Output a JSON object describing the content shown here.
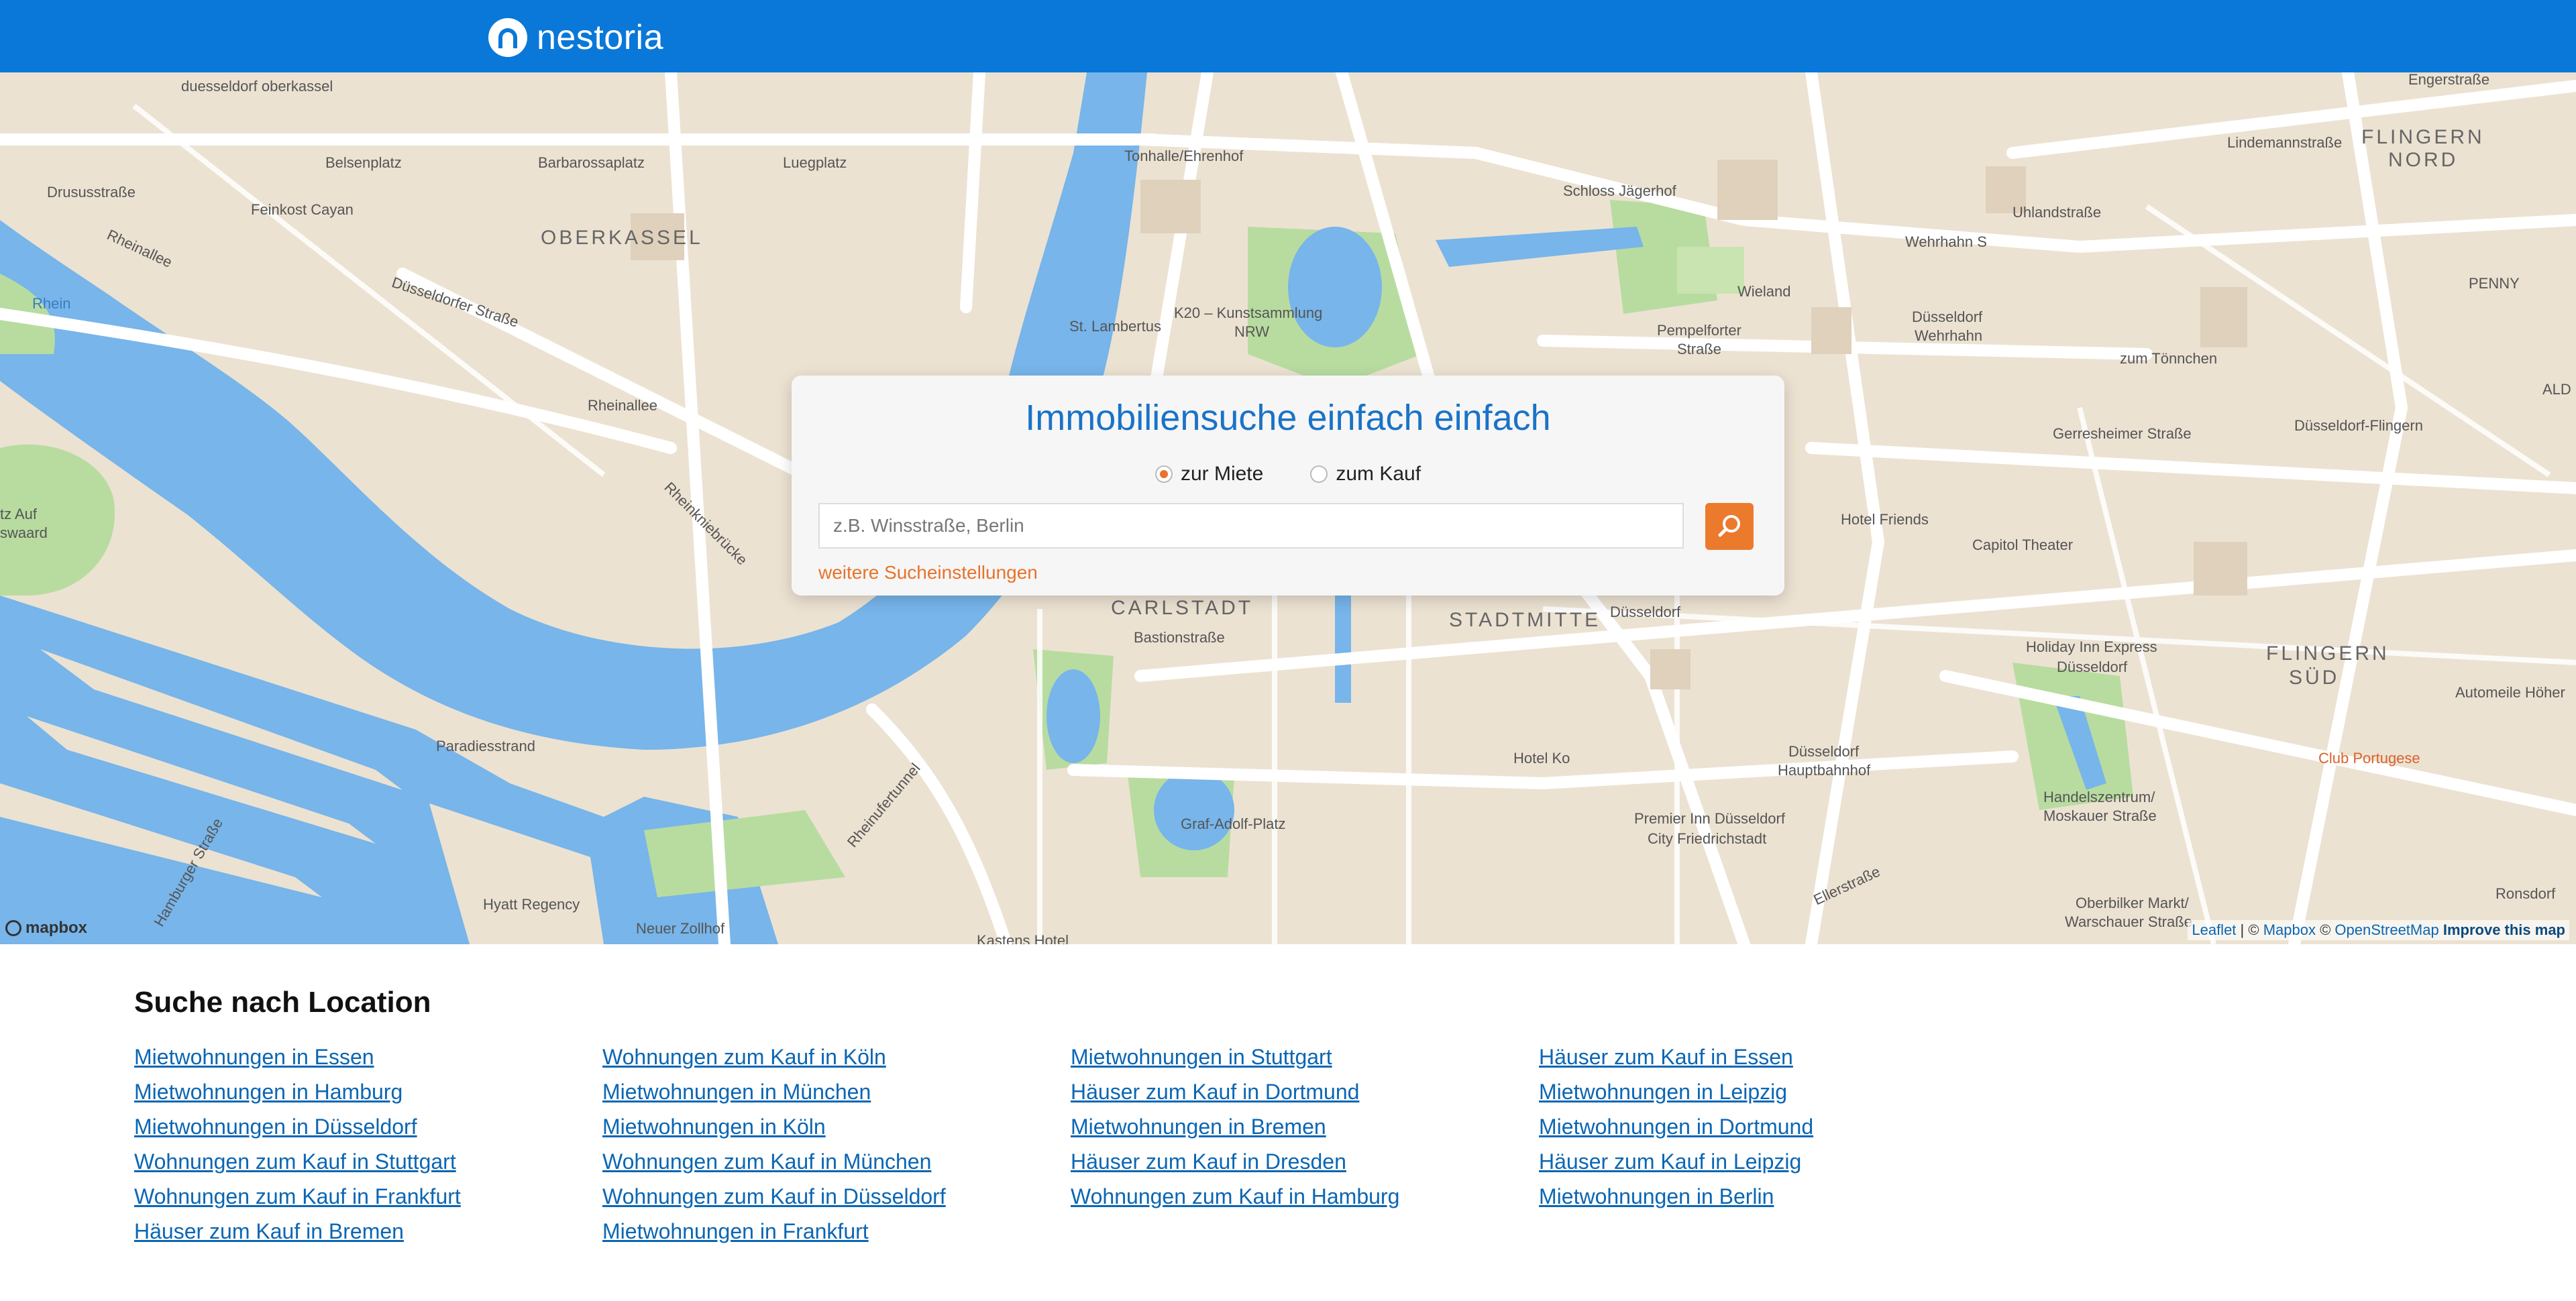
{
  "header": {
    "logo_text": "nestoria"
  },
  "search": {
    "title": "Immobiliensuche einfach einfach",
    "radio_rent": "zur Miete",
    "radio_buy": "zum Kauf",
    "selected": "zur Miete",
    "placeholder": "z.B. Winsstraße, Berlin",
    "more_settings": "weitere Sucheinstellungen"
  },
  "map": {
    "labels": {
      "l1": "duesseldorf oberkassel",
      "l2": "Belsenplatz",
      "l3": "Barbarossaplatz",
      "l4": "Luegplatz",
      "l5": "Tonhalle/Ehrenhof",
      "l6": "Drususstraße",
      "l7": "Feinkost Cayan",
      "l8": "OBERKASSEL",
      "l9": "Düsseldorfer Straße",
      "l10": "Rheinallee",
      "l11": "Rhein",
      "l12": "St. Lambertus",
      "l13": "K20 – Kunstsammlung",
      "l14": "NRW",
      "l15": "Schloss Jägerhof",
      "l16": "Wieland",
      "l17": "Pempelforter",
      "l18": "Straße",
      "l19": "Wehrhahn S",
      "l20": "Uhlandstraße",
      "l21": "Düsseldorf",
      "l22": "Wehrhahn",
      "l23": "Lindemannstraße",
      "l24": "FLINGERN",
      "l25": "NORD",
      "l26": "PENNY",
      "l27": "zum Tönnchen",
      "l28": "Düsseldorf-Flingern",
      "l29": "Gerresheimer Straße",
      "l30": "Hotel Friends",
      "l31": "Capitol Theater",
      "l32": "CARLSTADT",
      "l33": "STADTMITTE",
      "l34": "Bastionstraße",
      "l35": "Holiday Inn Express",
      "l36": "Düsseldorf",
      "l37": "FLINGERN",
      "l38": "SÜD",
      "l39": "Automeile Höher",
      "l40": "Club Portugese",
      "l41": "Düsseldorf",
      "l42": "Hauptbahnhof",
      "l43": "Hotel Ko",
      "l44": "Handelszentrum/",
      "l45": "Moskauer Straße",
      "l46": "Paradiesstrand",
      "l47": "Graf-Adolf-Platz",
      "l48": "Premier Inn Düsseldorf",
      "l49": "City Friedrichstadt",
      "l50": "Hyatt Regency",
      "l51": "Neuer Zollhof",
      "l52": "Kastens Hotel",
      "l53": "Oberbilker Markt/",
      "l54": "Warschauer Straße",
      "l55": "Engerstraße",
      "l56": "Rheinallee",
      "l57": "Hamburger Straße",
      "l58": "Rheinufertunnel",
      "l59": "Ellerstraße",
      "l60": "Rheinkniebrücke",
      "l61": "ALD",
      "l62": "Ronsdorf",
      "l63": "Düsseldorf",
      "l64": "tz Auf",
      "l65": "swaard"
    },
    "mapbox": "mapbox",
    "attribution": {
      "leaflet": "Leaflet",
      "sep1": " | © ",
      "mapbox": "Mapbox",
      "sep2": " © ",
      "osm": "OpenStreetMap",
      "improve": "Improve this map"
    }
  },
  "locations": {
    "title": "Suche nach Location",
    "columns": [
      [
        "Mietwohnungen in Essen",
        "Mietwohnungen in Hamburg",
        "Mietwohnungen in Düsseldorf",
        "Wohnungen zum Kauf in Stuttgart",
        "Wohnungen zum Kauf in Frankfurt",
        "Häuser zum Kauf in Bremen"
      ],
      [
        "Wohnungen zum Kauf in Köln",
        "Mietwohnungen in München",
        "Mietwohnungen in Köln",
        "Wohnungen zum Kauf in München",
        "Wohnungen zum Kauf in Düsseldorf",
        "Mietwohnungen in Frankfurt"
      ],
      [
        "Mietwohnungen in Stuttgart",
        "Häuser zum Kauf in Dortmund",
        "Mietwohnungen in Bremen",
        "Häuser zum Kauf in Dresden",
        "Wohnungen zum Kauf in Hamburg"
      ],
      [
        "Häuser zum Kauf in Essen",
        "Mietwohnungen in Leipzig",
        "Mietwohnungen in Dortmund",
        "Häuser zum Kauf in Leipzig",
        "Mietwohnungen in Berlin"
      ]
    ]
  },
  "colors": {
    "header": "#0a78d8",
    "accent": "#ec7a2c",
    "link": "#0b66b3",
    "water": "#77b5ea",
    "park": "#b8dca0",
    "land": "#ece2d2"
  }
}
